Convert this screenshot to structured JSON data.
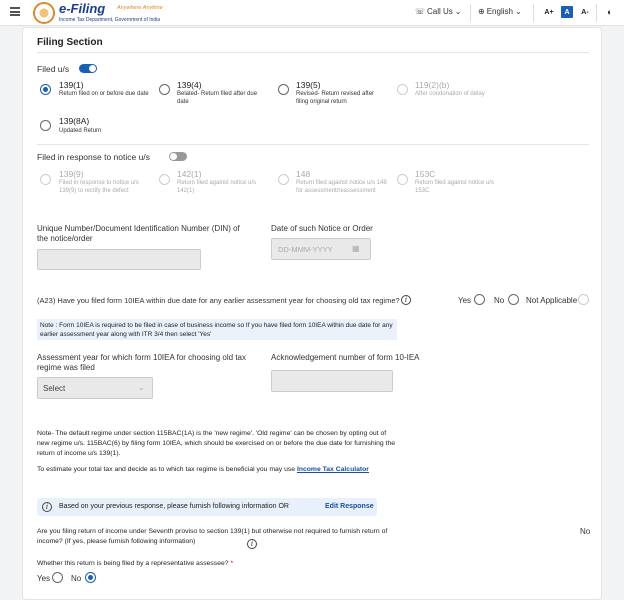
{
  "topbar": {
    "logo_title": "e-Filing",
    "logo_tagline": "Anywhere Anytime",
    "logo_sub": "Income Tax Department, Government of India",
    "call_us": "Call Us",
    "language": "English",
    "font_increase": "A+",
    "font_normal": "A",
    "font_decrease": "A-"
  },
  "filing": {
    "section_title": "Filing Section",
    "filed_us_label": "Filed u/s",
    "filed_us_toggle": "on",
    "options": [
      {
        "title": "139(1)",
        "desc": "Return filed on or before due date",
        "selected": true
      },
      {
        "title": "139(4)",
        "desc": "Belated- Return filed after due date",
        "selected": false
      },
      {
        "title": "139(5)",
        "desc": "Revised- Return revised after filing original return",
        "selected": false
      },
      {
        "title": "119(2)(b)",
        "desc": "After condonation of delay",
        "selected": false,
        "disabled": true
      },
      {
        "title": "139(8A)",
        "desc": "Updated Return",
        "selected": false
      }
    ],
    "notice_label": "Filed in response to notice u/s",
    "notice_toggle": "off",
    "notice_options": [
      {
        "title": "139(9)",
        "desc": "Filed in response to notice u/s 139(9) to rectify the defect"
      },
      {
        "title": "142(1)",
        "desc": "Return filed against notice u/s 142(1)"
      },
      {
        "title": "148",
        "desc": "Return filed against notice u/s 148 for assessment/reassessment"
      },
      {
        "title": "153C",
        "desc": "Return filed against notice u/s 153C"
      }
    ],
    "din_label": "Unique Number/Document Identification Number (DIN) of the notice/order",
    "date_label": "Date of such Notice or Order",
    "date_placeholder": "DD-MMM-YYYY",
    "a23_question": "(A23) Have you filed form 10IEA within due date for any earlier assessment year for choosing old tax regime?",
    "a23_options": [
      "Yes",
      "No",
      "Not Applicable"
    ],
    "a23_note": "Note : Form 10IEA is required to be filed in case of business income so If you have filed form 10IEA within due date for any earlier assessment year along with ITR 3/4 then select 'Yes'",
    "ay_label": "Assessment year for which form 10IEA for choosing old tax regime was filed",
    "ay_select": "Select",
    "ack_label": "Acknowledgement number of form 10-IEA",
    "regime_note": "Note- The default regime under section 115BAC(1A) is the 'new regime'. 'Old regime' can be chosen by opting out of new regime u/s. 115BAC(6) by filing form 10IEA, which should be exercised on or before the due date for furnishing the return of income u/s 139(1).",
    "estimate_text": "To estimate your total tax and decide as to which tax regime is beneficial you may use",
    "calculator_link": "Income Tax Calculator",
    "info_text": "Based on your previous response, please furnish following information OR",
    "edit_response": "Edit Response",
    "seventh_proviso_q": "Are you filing return of income under Seventh proviso to section 139(1) but otherwise not required to furnish return of income? (If yes, please furnish following information)",
    "seventh_proviso_a": "No",
    "rep_assessee_q": "Whether this return is being filed by a representative assessee?",
    "rep_required": "*",
    "rep_options": [
      "Yes",
      "No"
    ],
    "rep_selected": "No"
  },
  "colors": {
    "accent": "#1a5fb4",
    "note_bg": "#eaf1fb",
    "link": "#1a4fa0"
  }
}
